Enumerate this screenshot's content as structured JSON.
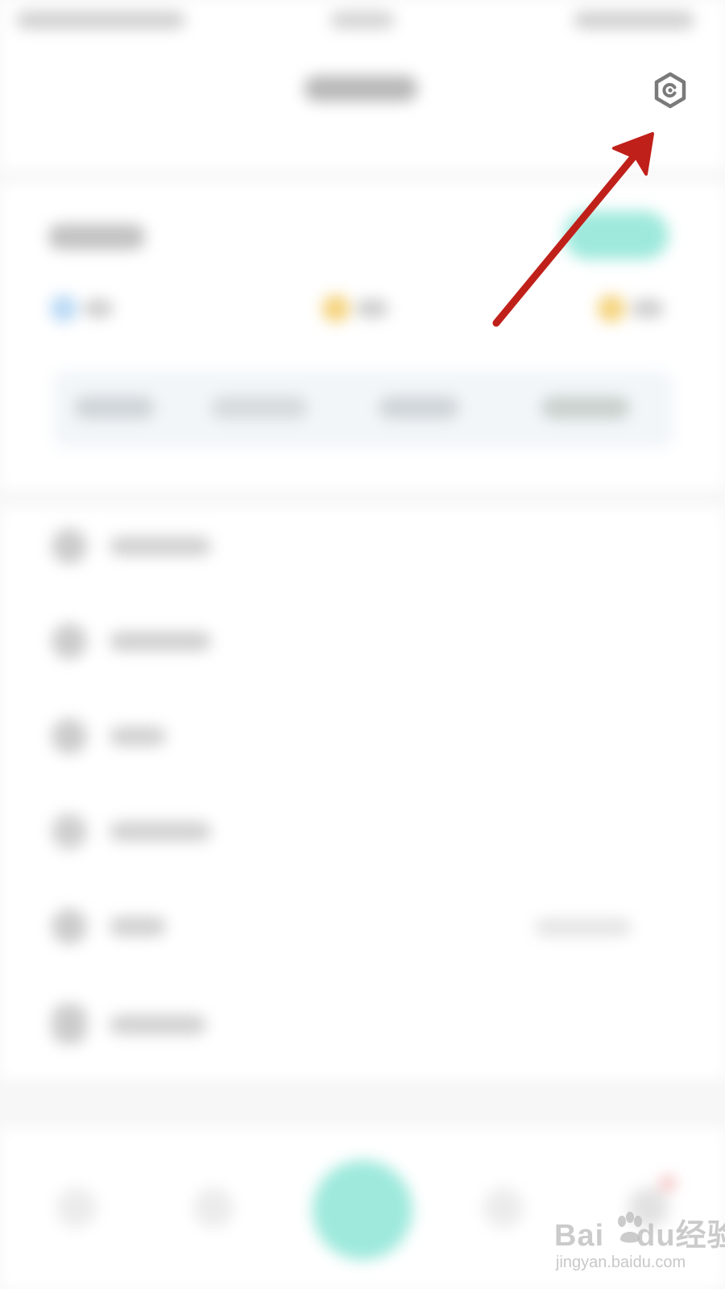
{
  "settings_button": {
    "icon": "settings-hexagon-icon",
    "color": "#7a7a7a"
  },
  "annotation": {
    "icon": "red-arrow-annotation",
    "color": "#c0201a"
  },
  "watermark": {
    "brand": "Bai",
    "brand_suffix": "du",
    "brand_cn": "经验",
    "site": "jingyan.baidu.com"
  },
  "colors": {
    "accent": "#9ee9dc",
    "coin": "#f5d27a",
    "blue": "#b9d9f5",
    "background": "#f7f7f7"
  }
}
